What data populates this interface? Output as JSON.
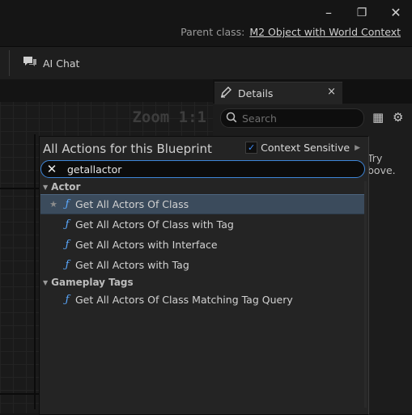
{
  "window_controls": {
    "minimize": "–",
    "restore": "❐",
    "close": "✕"
  },
  "parent_class": {
    "label": "Parent class:",
    "value": "M2 Object with World Context"
  },
  "toolbar": {
    "ai_chat_label": "AI Chat"
  },
  "graph": {
    "zoom_label": "Zoom 1:1"
  },
  "details_panel": {
    "tab_label": "Details",
    "tab_close": "×",
    "search_placeholder": "Search",
    "hint_line1": "Try",
    "hint_line2": "bove."
  },
  "action_menu": {
    "title": "All Actions for this Blueprint",
    "context_sensitive_label": "Context Sensitive",
    "context_sensitive_checked": true,
    "search_value": "getallactor",
    "categories": [
      {
        "name": "Actor",
        "items": [
          {
            "label": "Get All Actors Of Class",
            "selected": true,
            "favorite": true
          },
          {
            "label": "Get All Actors Of Class with Tag"
          },
          {
            "label": "Get All Actors with Interface"
          },
          {
            "label": "Get All Actors with Tag"
          }
        ]
      },
      {
        "name": "Gameplay Tags",
        "items": [
          {
            "label": "Get All Actors Of Class Matching Tag Query"
          }
        ]
      }
    ]
  },
  "icons": {
    "function_glyph": "ƒ",
    "star_glyph": "★",
    "clear_glyph": "✕",
    "settings_glyph": "⚙",
    "table_glyph": "▦"
  },
  "colors": {
    "accent": "#3e86d9",
    "selection": "#3b4b5c",
    "function_icon": "#5aa9ff"
  }
}
